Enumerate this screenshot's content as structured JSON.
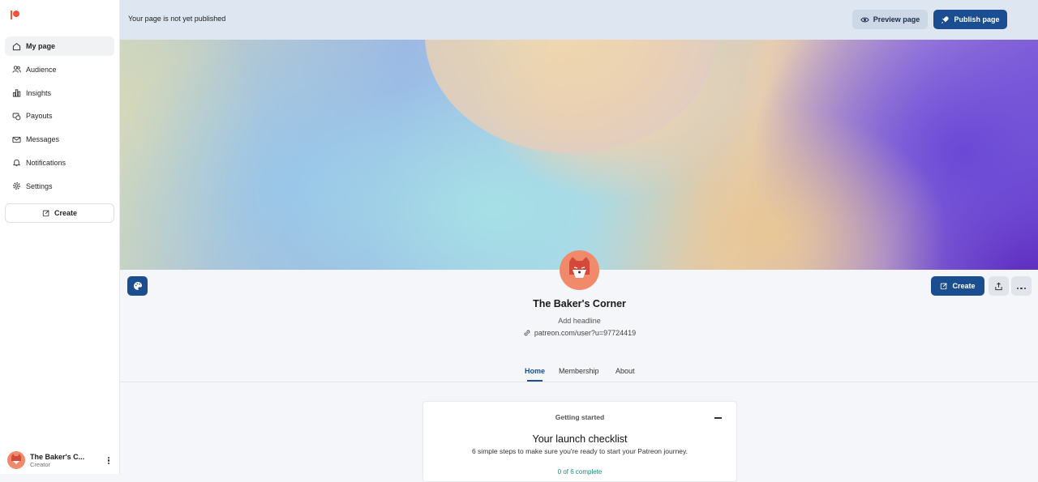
{
  "sidebar": {
    "logo": "patreon-logo",
    "items": [
      {
        "label": "My page",
        "icon": "home-icon",
        "active": true
      },
      {
        "label": "Audience",
        "icon": "users-icon"
      },
      {
        "label": "Insights",
        "icon": "bar-chart-icon"
      },
      {
        "label": "Payouts",
        "icon": "payouts-icon"
      },
      {
        "label": "Messages",
        "icon": "mail-icon"
      },
      {
        "label": "Notifications",
        "icon": "bell-icon"
      },
      {
        "label": "Settings",
        "icon": "gear-icon"
      }
    ],
    "create_label": "Create",
    "profile": {
      "name": "The Baker's C...",
      "role": "Creator"
    }
  },
  "topbar": {
    "message": "Your page is not yet published",
    "preview_label": "Preview page",
    "publish_label": "Publish page"
  },
  "creator": {
    "name": "The Baker's Corner",
    "headline": "Add headline",
    "url": "patreon.com/user?u=97724419"
  },
  "actions": {
    "create_label": "Create"
  },
  "tabs": [
    {
      "label": "Home",
      "active": true
    },
    {
      "label": "Membership"
    },
    {
      "label": "About"
    }
  ],
  "checklist": {
    "section": "Getting started",
    "title": "Your launch checklist",
    "subtitle": "6 simple steps to make sure you're ready to start your Patreon journey.",
    "progress": "0 of 6 complete"
  },
  "colors": {
    "accent": "#1b4e91",
    "brand": "#f4533c",
    "avatar": "#f08a6a"
  }
}
